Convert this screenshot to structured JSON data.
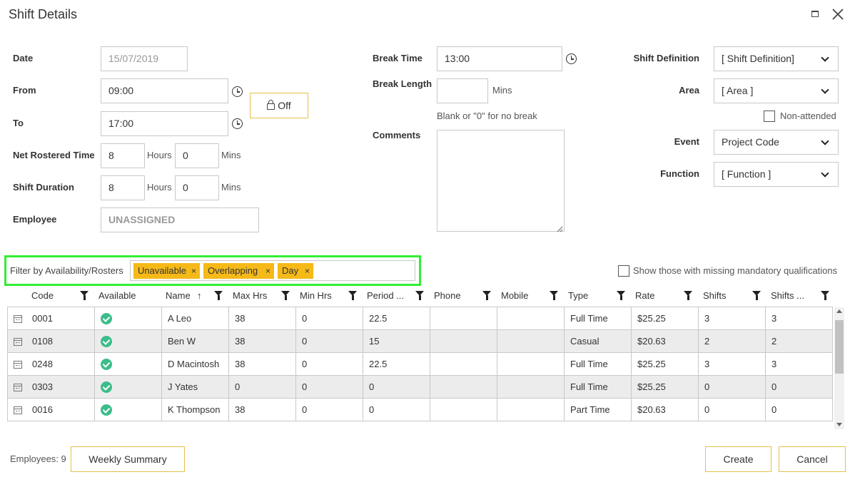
{
  "window": {
    "title": "Shift Details",
    "maximize_icon": "maximize-icon",
    "close_icon": "close-icon"
  },
  "form": {
    "date_label": "Date",
    "date_value": "15/07/2019",
    "from_label": "From",
    "from_value": "09:00",
    "to_label": "To",
    "to_value": "17:00",
    "off_label": "Off",
    "net_rostered_label": "Net Rostered Time",
    "net_hours": "8",
    "net_mins": "0",
    "duration_label": "Shift Duration",
    "duration_hours": "8",
    "duration_mins": "0",
    "hours_unit": "Hours",
    "mins_unit": "Mins",
    "employee_label": "Employee",
    "employee_value": "UNASSIGNED",
    "break_time_label": "Break Time",
    "break_time_value": "13:00",
    "break_length_label": "Break Length",
    "break_length_value": "",
    "break_mins_unit": "Mins",
    "break_hint": "Blank or \"0\" for no break",
    "comments_label": "Comments",
    "comments_value": "",
    "shift_definition_label": "Shift Definition",
    "shift_definition_value": "[ Shift Definition]",
    "area_label": "Area",
    "area_value": "[ Area ]",
    "non_attended_label": "Non-attended",
    "event_label": "Event",
    "event_value": "Project Code",
    "function_label": "Function",
    "function_value": "[ Function ]"
  },
  "filter": {
    "label": "Filter by Availability/Rosters",
    "tags": [
      "Unavailable",
      "Overlapping",
      "Day"
    ],
    "remove_glyph": "×",
    "missing_quals_label": "Show those with missing mandatory qualifications",
    "highlight_color": "#33ee33"
  },
  "grid": {
    "columns": [
      "Code",
      "Available",
      "Name",
      "Max Hrs",
      "Min Hrs",
      "Period ...",
      "Phone",
      "Mobile",
      "Type",
      "Rate",
      "Shifts",
      "Shifts ..."
    ],
    "sort_glyph": "↑",
    "rows": [
      {
        "code": "0001",
        "name": "A Leo",
        "max": "38",
        "min": "0",
        "period": "22.5",
        "phone": "",
        "mobile": "",
        "type": "Full Time",
        "rate": "$25.25",
        "shifts": "3",
        "shifts2": "3"
      },
      {
        "code": "0108",
        "name": "Ben W",
        "max": "38",
        "min": "0",
        "period": "15",
        "phone": "",
        "mobile": "",
        "type": "Casual",
        "rate": "$20.63",
        "shifts": "2",
        "shifts2": "2"
      },
      {
        "code": "0248",
        "name": "D Macintosh",
        "max": "38",
        "min": "0",
        "period": "22.5",
        "phone": "",
        "mobile": "",
        "type": "Full Time",
        "rate": "$25.25",
        "shifts": "3",
        "shifts2": "3"
      },
      {
        "code": "0303",
        "name": "J Yates",
        "max": "0",
        "min": "0",
        "period": "0",
        "phone": "",
        "mobile": "",
        "type": "Full Time",
        "rate": "$25.25",
        "shifts": "0",
        "shifts2": "0"
      },
      {
        "code": "0016",
        "name": "K Thompson",
        "max": "38",
        "min": "0",
        "period": "0",
        "phone": "",
        "mobile": "",
        "type": "Part Time",
        "rate": "$20.63",
        "shifts": "0",
        "shifts2": "0"
      }
    ]
  },
  "footer": {
    "employees_count": "Employees: 9",
    "weekly_summary_label": "Weekly Summary",
    "create_label": "Create",
    "cancel_label": "Cancel"
  },
  "colors": {
    "accent_border": "#e9c04a",
    "tag_bg": "#f5b918",
    "available_green": "#3cbd8b",
    "alt_row": "#ececec"
  }
}
